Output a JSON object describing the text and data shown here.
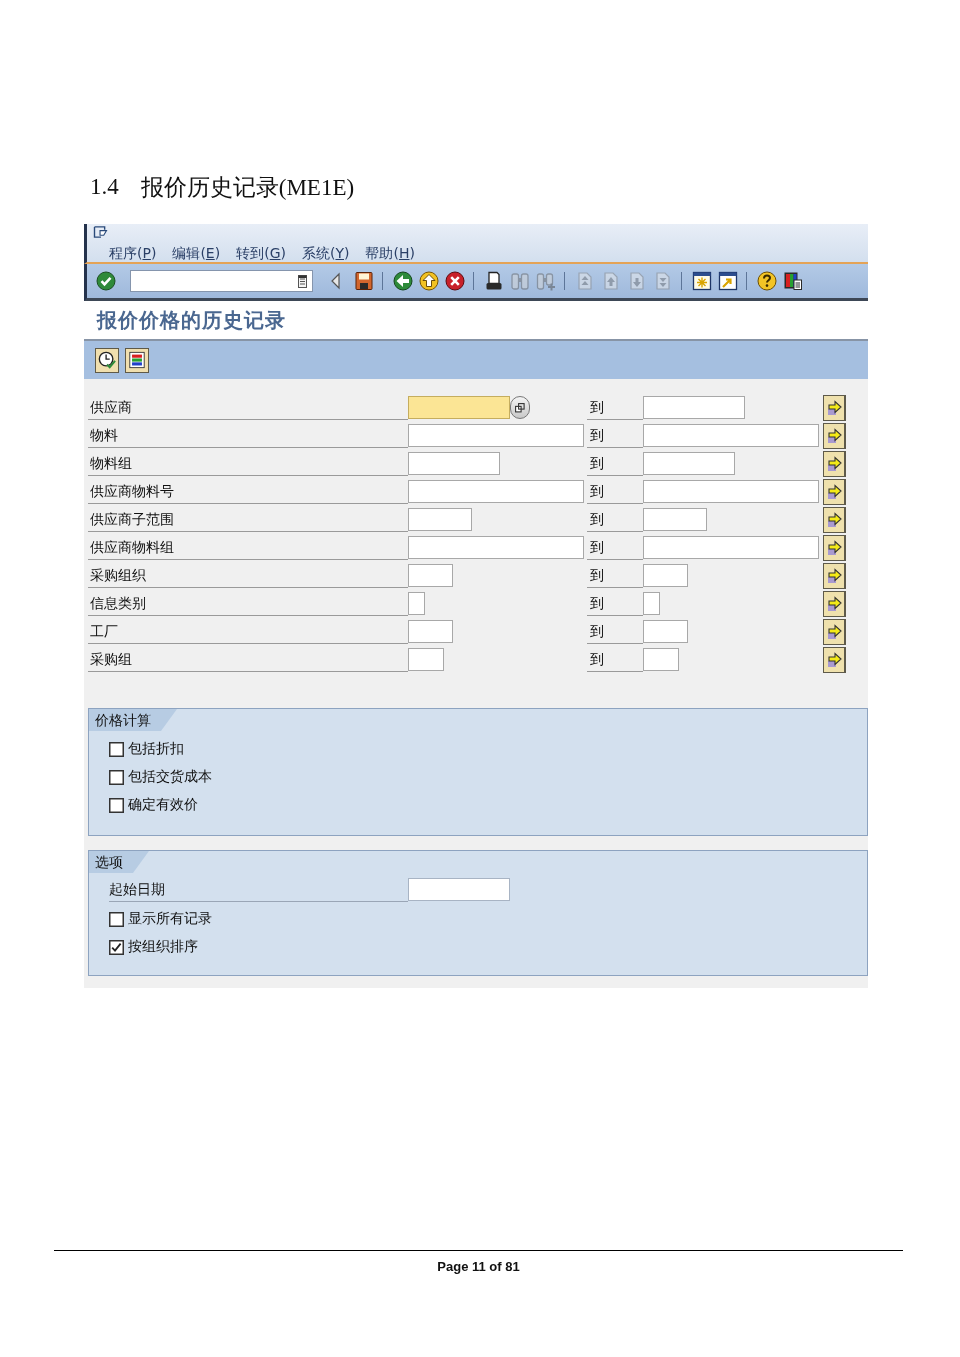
{
  "heading": {
    "number": "1.4",
    "title": "报价历史记录(ME1E)"
  },
  "menu_bar": [
    {
      "text": "程序(",
      "key": "P",
      "tail": ")"
    },
    {
      "text": "编辑(",
      "key": "E",
      "tail": ")"
    },
    {
      "text": "转到(",
      "key": "G",
      "tail": ")"
    },
    {
      "text": "系统(",
      "key": "Y",
      "tail": ")"
    },
    {
      "text": "帮助(",
      "key": "H",
      "tail": ")"
    }
  ],
  "toolbar": [
    {
      "buttons": [
        {
          "kind": "enter",
          "disabled": false
        },
        {
          "kind": "command",
          "disabled": false
        },
        {
          "kind": "toggle",
          "disabled": false
        },
        {
          "kind": "save",
          "disabled": false
        }
      ]
    },
    {
      "buttons": [
        {
          "kind": "back",
          "disabled": false
        },
        {
          "kind": "exit",
          "disabled": false
        },
        {
          "kind": "cancel",
          "disabled": false
        }
      ]
    },
    {
      "buttons": [
        {
          "kind": "print",
          "disabled": false
        },
        {
          "kind": "find",
          "disabled": true
        },
        {
          "kind": "findnext",
          "disabled": true
        }
      ]
    },
    {
      "buttons": [
        {
          "kind": "first",
          "disabled": true
        },
        {
          "kind": "prev",
          "disabled": true
        },
        {
          "kind": "next",
          "disabled": true
        },
        {
          "kind": "last",
          "disabled": true
        }
      ]
    },
    {
      "buttons": [
        {
          "kind": "session",
          "disabled": false
        },
        {
          "kind": "shortcut",
          "disabled": false
        }
      ]
    },
    {
      "buttons": [
        {
          "kind": "help",
          "disabled": false
        },
        {
          "kind": "layout",
          "disabled": false
        }
      ]
    }
  ],
  "screen_title": "报价价格的历史记录",
  "app_toolbar": [
    {
      "kind": "execute"
    },
    {
      "kind": "colors"
    }
  ],
  "selection_rows": [
    {
      "label": "供应商",
      "to_label": "到",
      "focused": true
    },
    {
      "label": "物料",
      "to_label": "到",
      "focused": false
    },
    {
      "label": "物料组",
      "to_label": "到",
      "focused": false
    },
    {
      "label": "供应商物料号",
      "to_label": "到",
      "focused": false
    },
    {
      "label": "供应商子范围",
      "to_label": "到",
      "focused": false
    },
    {
      "label": "供应商物料组",
      "to_label": "到",
      "focused": false
    },
    {
      "label": "采购组织",
      "to_label": "到",
      "focused": false
    },
    {
      "label": "信息类别",
      "to_label": "到",
      "focused": false
    },
    {
      "label": "工厂",
      "to_label": "到",
      "focused": false
    },
    {
      "label": "采购组",
      "to_label": "到",
      "focused": false
    }
  ],
  "groups": [
    {
      "title": "价格计算",
      "items": [
        {
          "kind": "checkbox",
          "label": "包括折扣",
          "checked": false
        },
        {
          "kind": "checkbox",
          "label": "包括交货成本",
          "checked": false
        },
        {
          "kind": "checkbox",
          "label": "确定有效价",
          "checked": false
        }
      ]
    },
    {
      "title": "选项",
      "items": [
        {
          "kind": "date",
          "label": "起始日期"
        },
        {
          "kind": "checkbox",
          "label": "显示所有记录",
          "checked": false
        },
        {
          "kind": "checkbox",
          "label": "按组织排序",
          "checked": true
        }
      ]
    }
  ],
  "footer": {
    "page": "Page 11 of 81"
  }
}
